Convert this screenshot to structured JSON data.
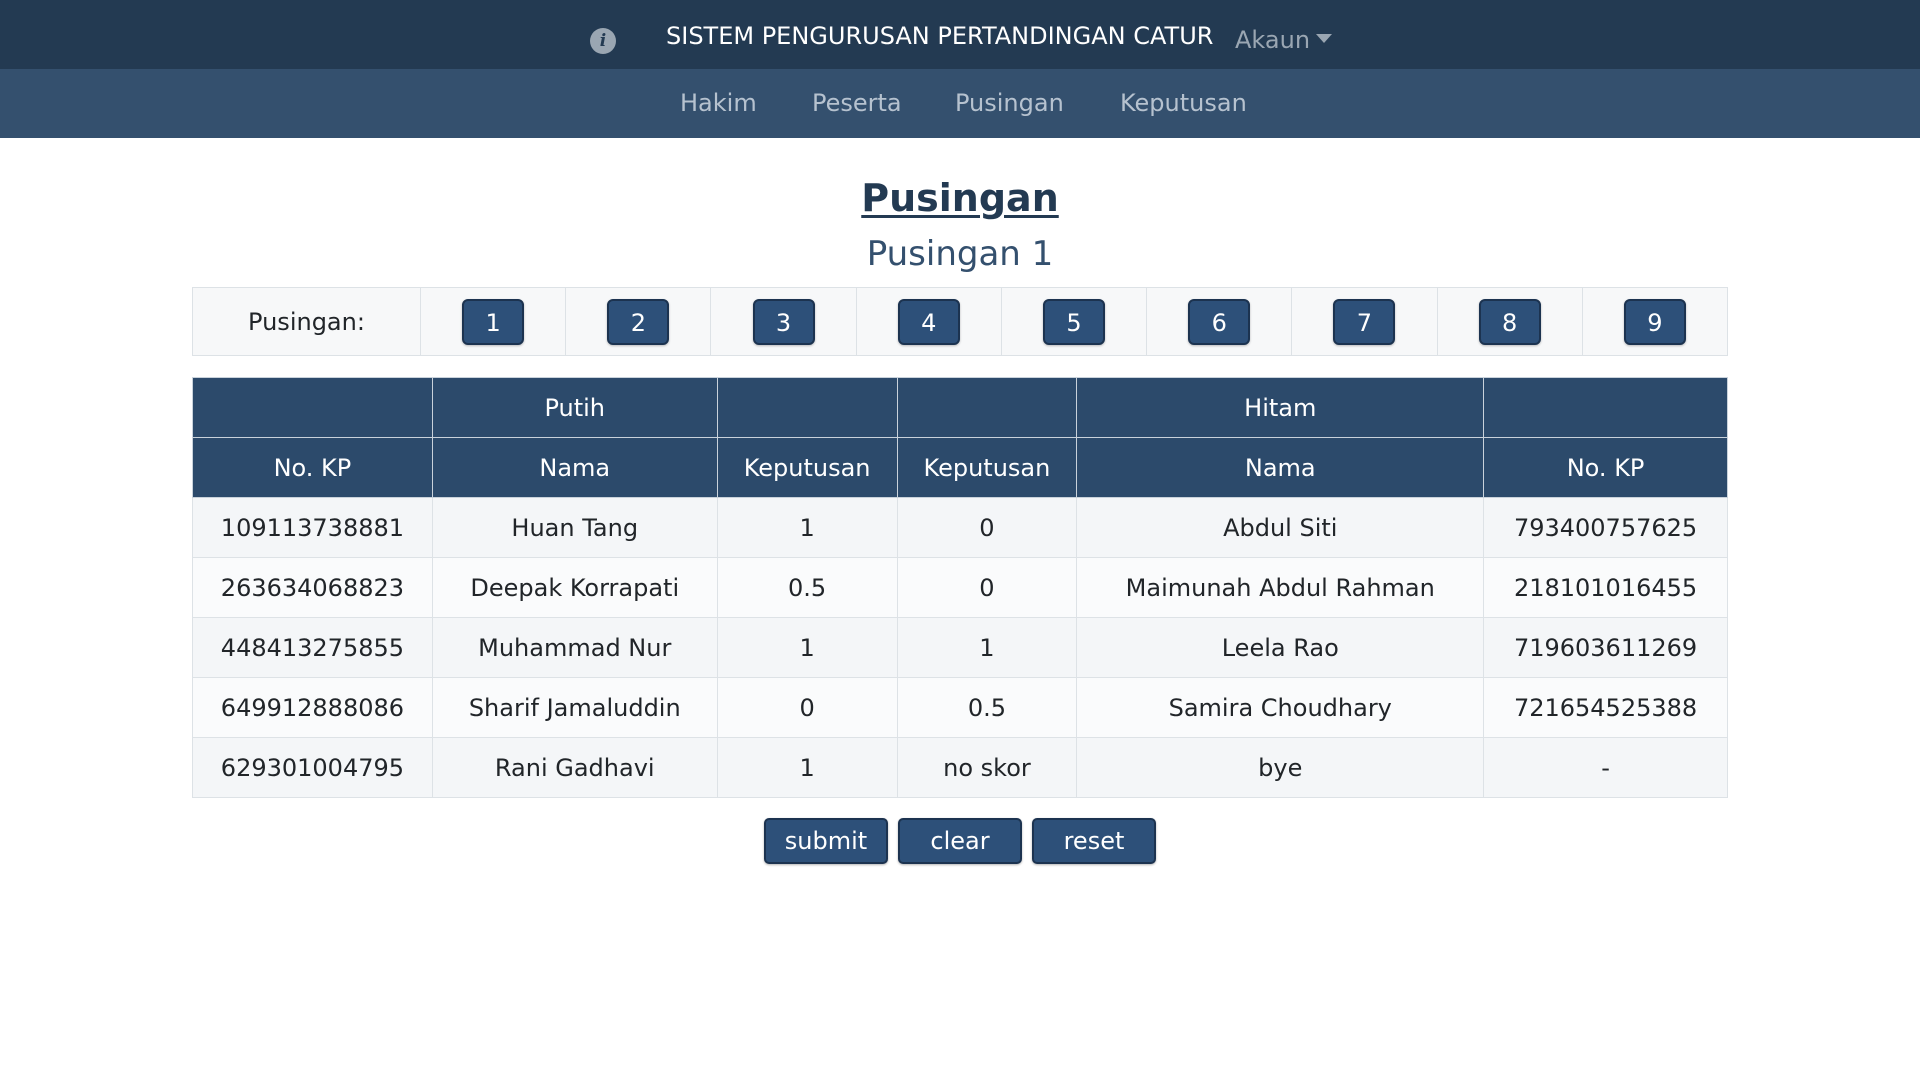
{
  "header": {
    "title": "SISTEM PENGURUSAN PERTANDINGAN CATUR",
    "info_icon": "info-icon",
    "account_label": "Akaun"
  },
  "nav": {
    "items": [
      {
        "label": "Hakim"
      },
      {
        "label": "Peserta"
      },
      {
        "label": "Pusingan"
      },
      {
        "label": "Keputusan"
      }
    ]
  },
  "main": {
    "page_title": "Pusingan",
    "subtitle": "Pusingan 1",
    "round_label": "Pusingan:",
    "rounds": [
      "1",
      "2",
      "3",
      "4",
      "5",
      "6",
      "7",
      "8",
      "9"
    ]
  },
  "table": {
    "group_headers": {
      "white": "Putih",
      "black": "Hitam"
    },
    "columns": [
      "No. KP",
      "Nama",
      "Keputusan",
      "Keputusan",
      "Nama",
      "No. KP"
    ],
    "rows": [
      {
        "white_id": "109113738881",
        "white_name": "Huan Tang",
        "white_result": "1",
        "black_result": "0",
        "black_name": "Abdul Siti",
        "black_id": "793400757625"
      },
      {
        "white_id": "263634068823",
        "white_name": "Deepak Korrapati",
        "white_result": "0.5",
        "black_result": "0",
        "black_name": "Maimunah Abdul Rahman",
        "black_id": "218101016455"
      },
      {
        "white_id": "448413275855",
        "white_name": "Muhammad Nur",
        "white_result": "1",
        "black_result": "1",
        "black_name": "Leela Rao",
        "black_id": "719603611269"
      },
      {
        "white_id": "649912888086",
        "white_name": "Sharif Jamaluddin",
        "white_result": "0",
        "black_result": "0.5",
        "black_name": "Samira Choudhary",
        "black_id": "721654525388"
      },
      {
        "white_id": "629301004795",
        "white_name": "Rani Gadhavi",
        "white_result": "1",
        "black_result": "no skor",
        "black_name": "bye",
        "black_id": "-"
      }
    ]
  },
  "actions": {
    "submit": "submit",
    "clear": "clear",
    "reset": "reset"
  },
  "colors": {
    "topbar": "#233a52",
    "subnav": "#34506e",
    "button": "#2d5079",
    "table_header": "#2c4a6b"
  }
}
